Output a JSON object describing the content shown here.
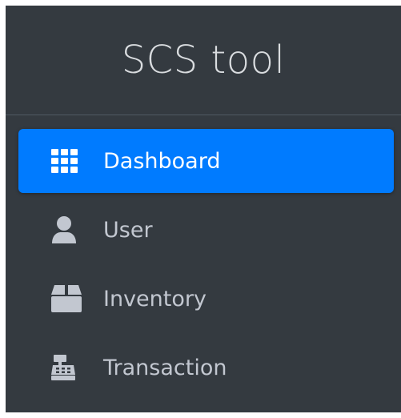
{
  "app": {
    "title": "SCS tool"
  },
  "colors": {
    "sidebar_bg": "#343a40",
    "active_bg": "#007bff",
    "text": "#c2c7d0",
    "active_text": "#ffffff"
  },
  "nav": {
    "items": [
      {
        "label": "Dashboard",
        "icon": "grid-icon",
        "active": true
      },
      {
        "label": "User",
        "icon": "user-icon",
        "active": false
      },
      {
        "label": "Inventory",
        "icon": "box-icon",
        "active": false
      },
      {
        "label": "Transaction",
        "icon": "cash-register-icon",
        "active": false
      }
    ]
  }
}
